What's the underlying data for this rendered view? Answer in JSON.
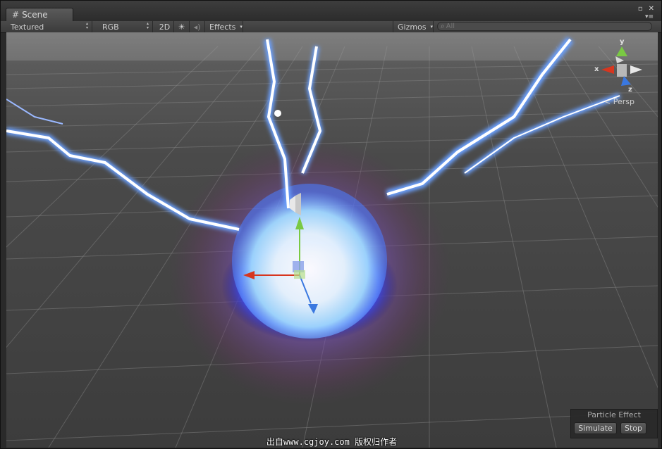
{
  "tab": {
    "title": "Scene",
    "icon": "grid-icon"
  },
  "window_buttons": {
    "maximize": "▫",
    "close": "✕",
    "menu": "▾≡"
  },
  "toolbar": {
    "render_mode": "Textured",
    "color_mode": "RGB",
    "mode_2d": "2D",
    "lighting_icon": "sun-icon",
    "audio_icon": "speaker-icon",
    "effects": "Effects",
    "gizmos": "Gizmos",
    "search_placeholder": "All"
  },
  "orientation_gizmo": {
    "x": "x",
    "y": "y",
    "z": "z",
    "projection": "Persp",
    "colors": {
      "x": "#d7361f",
      "y": "#7ac943",
      "z": "#3a78e0"
    }
  },
  "particle_panel": {
    "title": "Particle Effect",
    "simulate": "Simulate",
    "stop": "Stop"
  },
  "watermark": "出自www.cgjoy.com 版权归作者"
}
